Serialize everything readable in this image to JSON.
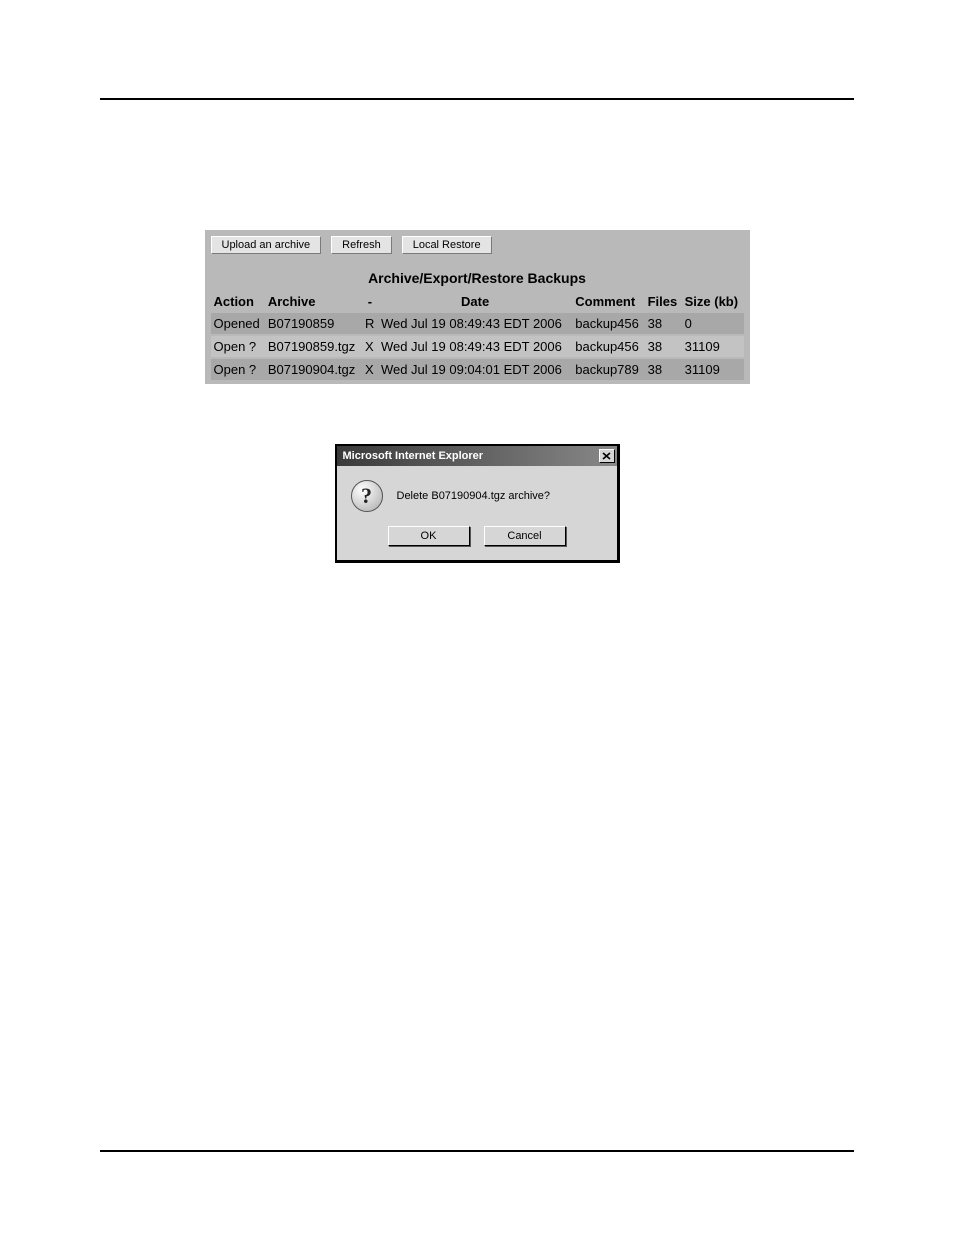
{
  "toolbar": {
    "upload_label": "Upload an archive",
    "refresh_label": "Refresh",
    "local_restore_label": "Local Restore"
  },
  "panel": {
    "title": "Archive/Export/Restore Backups"
  },
  "headers": {
    "action": "Action",
    "archive": "Archive",
    "dash": "-",
    "date": "Date",
    "comment": "Comment",
    "files": "Files",
    "size": "Size (kb)"
  },
  "rows": [
    {
      "action": "Opened",
      "archive": "B07190859",
      "flag": "R",
      "date": "Wed Jul 19 08:49:43 EDT 2006",
      "comment": "backup456",
      "files": "38",
      "size": "0"
    },
    {
      "action": "Open ?",
      "archive": "B07190859.tgz",
      "flag": "X",
      "date": "Wed Jul 19 08:49:43 EDT 2006",
      "comment": "backup456",
      "files": "38",
      "size": "31109"
    },
    {
      "action": "Open ?",
      "archive": "B07190904.tgz",
      "flag": "X",
      "date": "Wed Jul 19 09:04:01 EDT 2006",
      "comment": "backup789",
      "files": "38",
      "size": "31109"
    }
  ],
  "dialog": {
    "title": "Microsoft Internet Explorer",
    "message": "Delete B07190904.tgz archive?",
    "ok_label": "OK",
    "cancel_label": "Cancel",
    "question_glyph": "?"
  }
}
